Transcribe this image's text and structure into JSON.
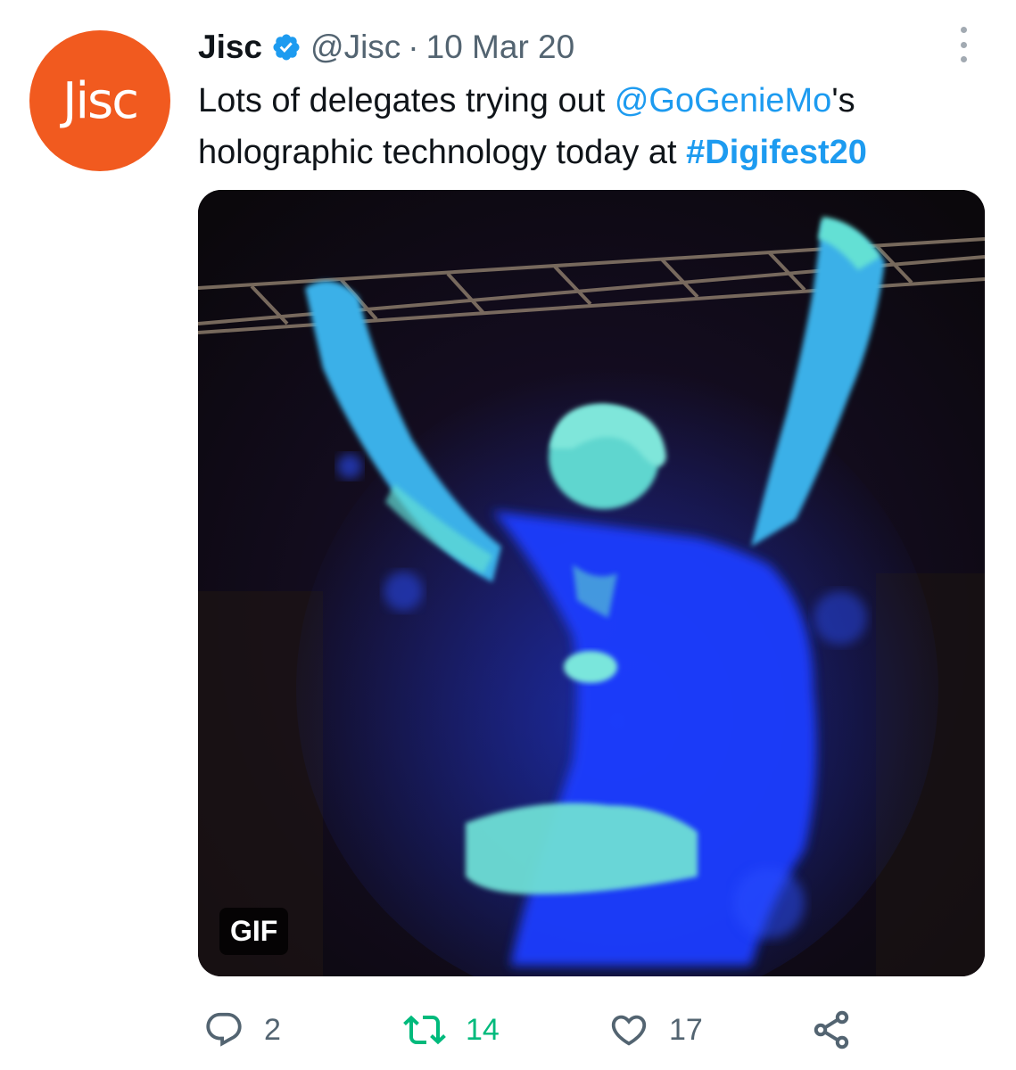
{
  "avatar": {
    "text": "Jisc",
    "color": "#f15a1f"
  },
  "header": {
    "name": "Jisc",
    "verified_icon": "verified-badge-icon",
    "handle": "@Jisc",
    "separator": "·",
    "date": "10 Mar 20",
    "more_icon": "more-options-icon"
  },
  "tweet": {
    "text_before": "Lots of delegates trying out ",
    "mention": "@GoGenieMo",
    "text_middle": "'s holographic technology today at ",
    "hashtag": "#Digifest20"
  },
  "media": {
    "badge": "GIF",
    "subject": "holographic-figure-image"
  },
  "actions": {
    "reply": {
      "icon": "reply-icon",
      "count": "2"
    },
    "retweet": {
      "icon": "retweet-icon",
      "count": "14",
      "color": "#00ba7c"
    },
    "like": {
      "icon": "heart-icon",
      "count": "17"
    },
    "share": {
      "icon": "share-icon"
    }
  },
  "colors": {
    "link": "#1d9bf0",
    "muted": "#536471",
    "text": "#0f1419"
  }
}
